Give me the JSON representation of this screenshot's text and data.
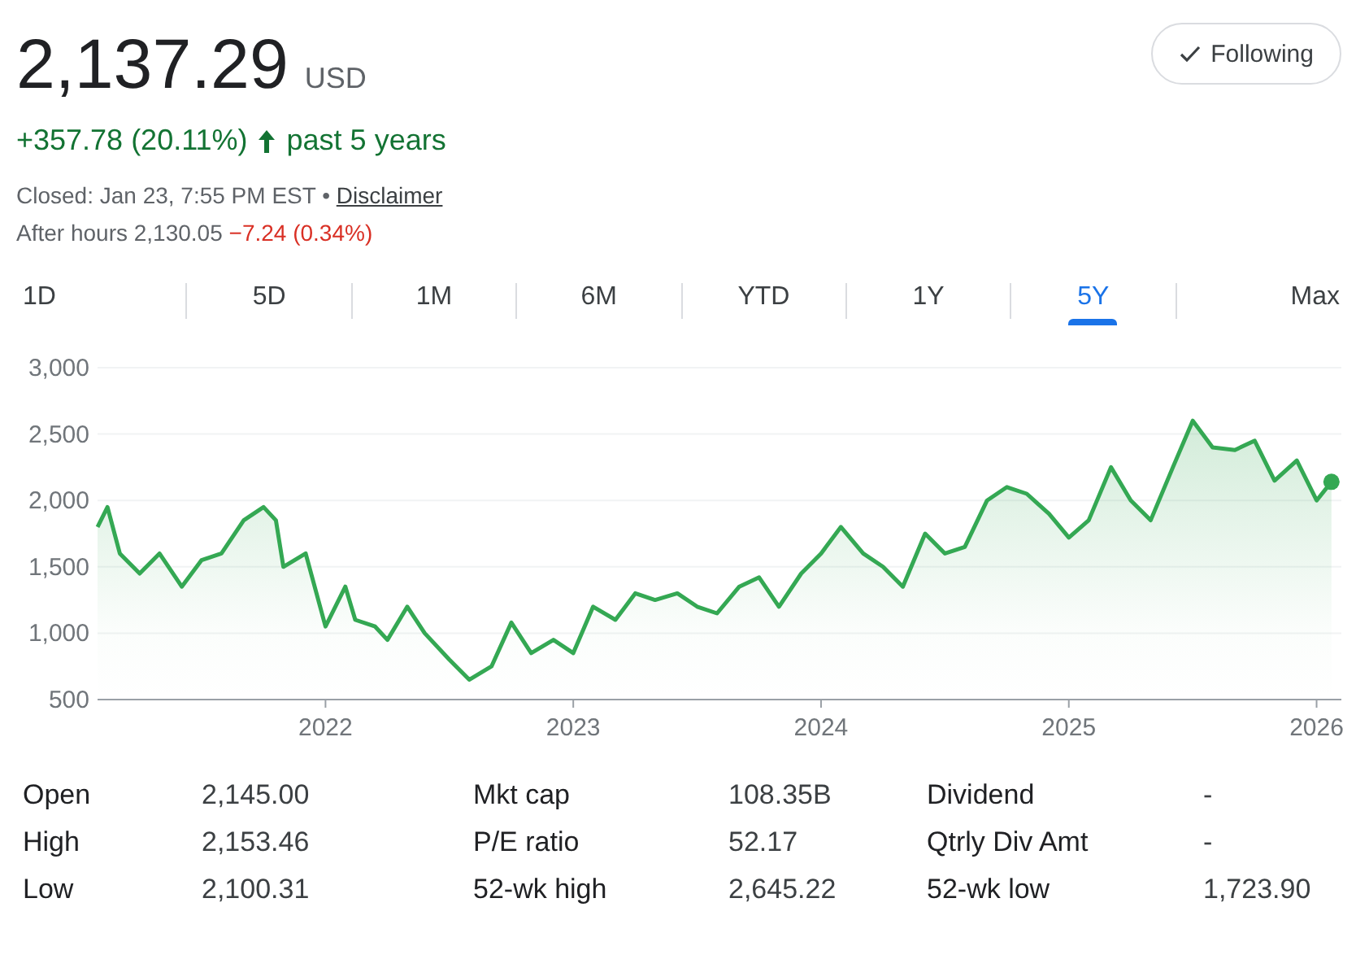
{
  "quote": {
    "price": "2,137.29",
    "currency": "USD",
    "change": "+357.78 (20.11%)",
    "rising": true,
    "period": "past 5 years",
    "closed": "Closed: Jan 23, 7:55 PM EST",
    "separator": "•",
    "disclaimer": "Disclaimer",
    "after_hours_label": "After hours 2,130.05",
    "after_hours_change": "−7.24 (0.34%)"
  },
  "follow_button": {
    "label": "Following",
    "checked": true
  },
  "tabs": [
    {
      "label": "1D",
      "selected": false
    },
    {
      "label": "5D",
      "selected": false
    },
    {
      "label": "1M",
      "selected": false
    },
    {
      "label": "6M",
      "selected": false
    },
    {
      "label": "YTD",
      "selected": false
    },
    {
      "label": "1Y",
      "selected": false
    },
    {
      "label": "5Y",
      "selected": true
    },
    {
      "label": "Max",
      "selected": false
    }
  ],
  "chart_data": {
    "type": "area",
    "x": [
      2021.08,
      2021.12,
      2021.17,
      2021.25,
      2021.33,
      2021.42,
      2021.5,
      2021.58,
      2021.67,
      2021.75,
      2021.8,
      2021.83,
      2021.92,
      2022.0,
      2022.08,
      2022.12,
      2022.2,
      2022.25,
      2022.33,
      2022.4,
      2022.5,
      2022.58,
      2022.67,
      2022.75,
      2022.83,
      2022.92,
      2023.0,
      2023.08,
      2023.17,
      2023.25,
      2023.33,
      2023.42,
      2023.5,
      2023.58,
      2023.67,
      2023.75,
      2023.83,
      2023.92,
      2024.0,
      2024.08,
      2024.17,
      2024.25,
      2024.33,
      2024.42,
      2024.5,
      2024.58,
      2024.67,
      2024.75,
      2024.83,
      2024.92,
      2025.0,
      2025.08,
      2025.17,
      2025.25,
      2025.33,
      2025.42,
      2025.5,
      2025.58,
      2025.67,
      2025.75,
      2025.83,
      2025.92,
      2026.0,
      2026.06
    ],
    "grid": true,
    "series": [
      {
        "color": "#34a853",
        "values": [
          1800,
          1950,
          1600,
          1450,
          1600,
          1350,
          1550,
          1600,
          1850,
          1950,
          1850,
          1500,
          1600,
          1050,
          1350,
          1100,
          1050,
          950,
          1200,
          1000,
          800,
          650,
          750,
          1080,
          850,
          950,
          850,
          1200,
          1100,
          1300,
          1250,
          1300,
          1200,
          1150,
          1350,
          1420,
          1200,
          1450,
          1600,
          1800,
          1600,
          1500,
          1350,
          1750,
          1600,
          1650,
          2000,
          2100,
          2050,
          1900,
          1720,
          1850,
          2250,
          2000,
          1850,
          2250,
          2600,
          2400,
          2380,
          2450,
          2150,
          2300,
          2000,
          2140
        ]
      }
    ],
    "xlim": [
      2021.08,
      2026.1
    ],
    "ylim": [
      500,
      3000
    ],
    "xticks": [
      {
        "value": 2022,
        "label": "2022"
      },
      {
        "value": 2023,
        "label": "2023"
      },
      {
        "value": 2024,
        "label": "2024"
      },
      {
        "value": 2025,
        "label": "2025"
      },
      {
        "value": 2026,
        "label": "2026"
      }
    ],
    "yticks": [
      {
        "value": 500,
        "label": "500"
      },
      {
        "value": 1000,
        "label": "1,000"
      },
      {
        "value": 1500,
        "label": "1,500"
      },
      {
        "value": 2000,
        "label": "2,000"
      },
      {
        "value": 2500,
        "label": "2,500"
      },
      {
        "value": 3000,
        "label": "3,000"
      }
    ]
  },
  "stats": [
    [
      {
        "label": "Open",
        "value": "2,145.00"
      },
      {
        "label": "High",
        "value": "2,153.46"
      },
      {
        "label": "Low",
        "value": "2,100.31"
      }
    ],
    [
      {
        "label": "Mkt cap",
        "value": "108.35B"
      },
      {
        "label": "P/E ratio",
        "value": "52.17"
      },
      {
        "label": "52-wk high",
        "value": "2,645.22"
      }
    ],
    [
      {
        "label": "Dividend",
        "value": "-"
      },
      {
        "label": "Qtrly Div Amt",
        "value": "-"
      },
      {
        "label": "52-wk low",
        "value": "1,723.90"
      }
    ]
  ]
}
